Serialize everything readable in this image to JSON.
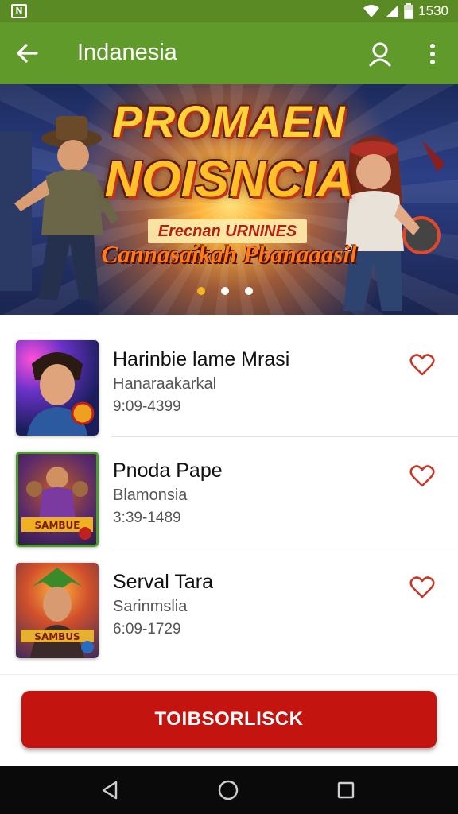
{
  "status_bar": {
    "time": "1530",
    "notification_icon": "app-notification-icon",
    "wifi_icon": "wifi-icon",
    "signal_icon": "cell-signal-icon",
    "battery_icon": "battery-icon"
  },
  "app_bar": {
    "title": "Indanesia",
    "back_icon": "arrow-left-icon",
    "search_icon": "search-icon",
    "more_icon": "more-vert-icon",
    "background_color": "#5f9a2a"
  },
  "banner": {
    "headline_line1": "PROMAEN",
    "headline_line2": "NOISNCIA",
    "subtitle_line1": "Erecnan URNINES",
    "subtitle_line2": "Cannasaikah Pbanaaasil",
    "slides_total": 3,
    "active_slide": 1
  },
  "games": [
    {
      "title": "Harinbie lame Mrasi",
      "subtitle": "Hanaraakarkal",
      "meta": "9:09-4399",
      "favorite_icon": "heart-outline-icon"
    },
    {
      "title": "Pnoda Pape",
      "subtitle": "Blamonsia",
      "meta": "3:39-1489",
      "favorite_icon": "heart-outline-icon"
    },
    {
      "title": "Serval Tara",
      "subtitle": "Sarinmslia",
      "meta": "6:09-1729",
      "favorite_icon": "heart-outline-icon"
    }
  ],
  "primary_action": {
    "label": "TOIBSORLISCK",
    "color": "#c4140f"
  },
  "nav_bar": {
    "back_icon": "nav-back-triangle-icon",
    "home_icon": "nav-home-circle-icon",
    "recents_icon": "nav-recents-square-icon"
  }
}
